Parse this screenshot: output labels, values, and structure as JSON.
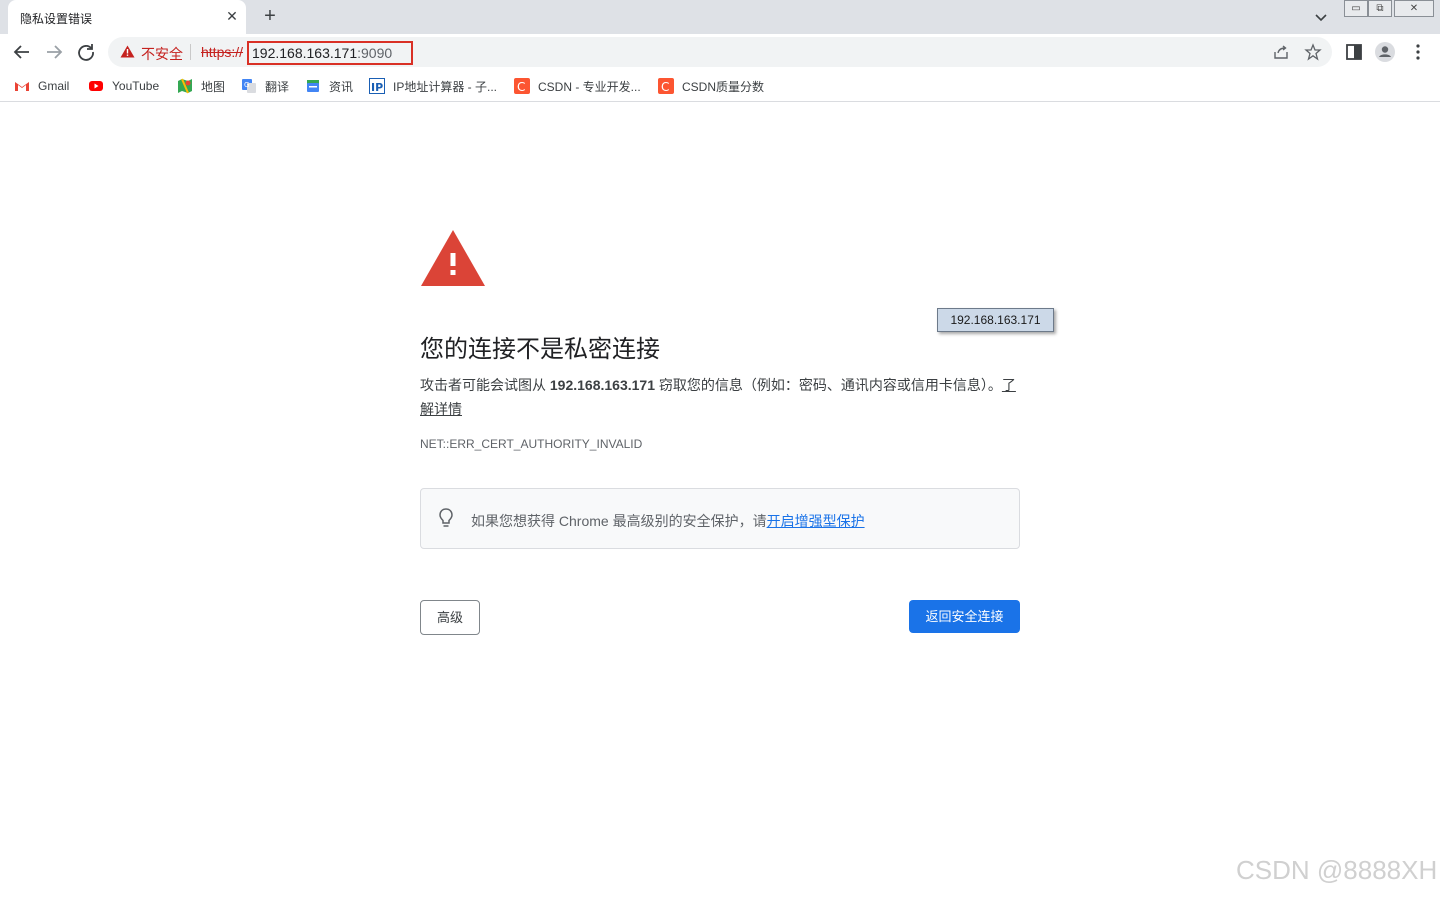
{
  "tab": {
    "title": "隐私设置错误",
    "close": "✕",
    "new_tab": "+"
  },
  "window_controls": {
    "minimize": "▭",
    "restore": "⧉",
    "close": "✕"
  },
  "toolbar": {
    "back_icon": "arrow-left-icon",
    "forward_icon": "arrow-right-icon",
    "reload_icon": "reload-icon"
  },
  "address": {
    "security_label": "不安全",
    "scheme": "https://",
    "host": "192.168.163.171",
    "port": ":9090"
  },
  "bookmarks": [
    {
      "label": "Gmail",
      "icon": "gmail-icon"
    },
    {
      "label": "YouTube",
      "icon": "youtube-icon"
    },
    {
      "label": "地图",
      "icon": "maps-icon"
    },
    {
      "label": "翻译",
      "icon": "translate-icon"
    },
    {
      "label": "资讯",
      "icon": "news-icon"
    },
    {
      "label": "IP地址计算器 - 子...",
      "icon": "ip-icon"
    },
    {
      "label": "CSDN - 专业开发...",
      "icon": "csdn-icon"
    },
    {
      "label": "CSDN质量分数",
      "icon": "csdn-icon"
    }
  ],
  "page": {
    "heading": "您的连接不是私密连接",
    "desc_before": "攻击者可能会试图从 ",
    "desc_host": "192.168.163.171",
    "desc_after": " 窃取您的信息（例如：密码、通讯内容或信用卡信息）。",
    "learn_more": "了解详情",
    "error_code": "NET::ERR_CERT_AUTHORITY_INVALID",
    "tip_text": "如果您想获得 Chrome 最高级别的安全保护，请",
    "tip_link": "开启增强型保护",
    "advanced_button": "高级",
    "back_button": "返回安全连接"
  },
  "tooltip": "192.168.163.171",
  "watermark": "CSDN @8888XH",
  "colors": {
    "danger": "#d93025",
    "accent": "#1a73e8"
  }
}
